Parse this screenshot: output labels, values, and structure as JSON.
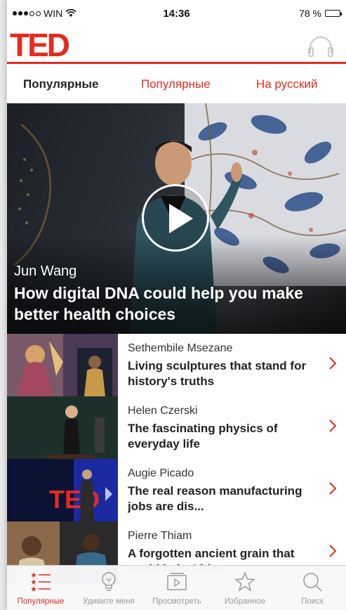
{
  "status_bar": {
    "carrier": "WIN",
    "time": "14:36",
    "battery": "78 %",
    "battery_level": 0.78
  },
  "header": {
    "logo": "TED",
    "icons": [
      "headphones-icon"
    ]
  },
  "tabs": [
    {
      "label": "Популярные",
      "active": true
    },
    {
      "label": "Популярные",
      "active": false
    },
    {
      "label": "На русский",
      "active": false
    }
  ],
  "hero": {
    "speaker": "Jun Wang",
    "title": "How digital DNA could help you make better health choices"
  },
  "talks": [
    {
      "speaker": "Sethembile Msezane",
      "title": "Living sculptures that stand for history's truths"
    },
    {
      "speaker": "Helen Czerski",
      "title": "The fascinating physics of everyday life"
    },
    {
      "speaker": "Augie Picado",
      "title": "The real reason manufacturing jobs are dis..."
    },
    {
      "speaker": "Pierre Thiam",
      "title": "A forgotten ancient grain that could help Africa"
    }
  ],
  "tab_bar": [
    {
      "label": "Популярные",
      "icon": "list-icon",
      "active": true
    },
    {
      "label": "Удивите меня",
      "icon": "lightbulb-icon",
      "active": false
    },
    {
      "label": "Просмотреть",
      "icon": "browse-icon",
      "active": false
    },
    {
      "label": "Избранное",
      "icon": "star-icon",
      "active": false
    },
    {
      "label": "Поиск",
      "icon": "search-icon",
      "active": false
    }
  ],
  "colors": {
    "accent": "#e62b1e",
    "inactive": "#9a9a9a"
  }
}
